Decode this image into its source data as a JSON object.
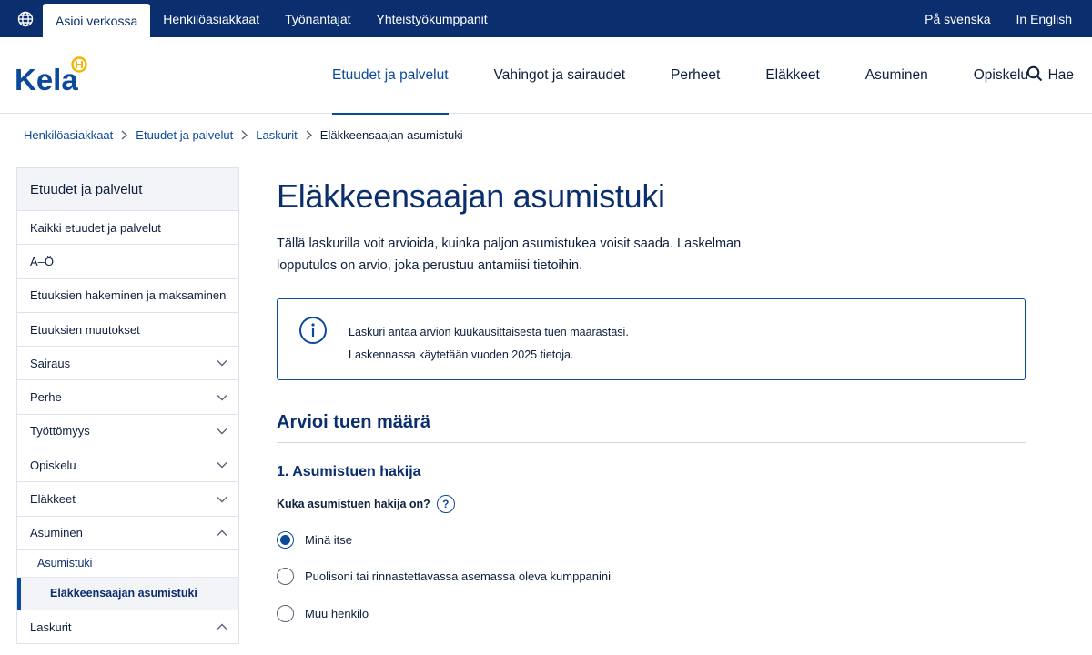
{
  "topbar": {
    "tabs": [
      "Asioi verkossa",
      "Henkilöasiakkaat",
      "Työnantajat",
      "Yhteistyökumppanit"
    ],
    "languages": [
      "På svenska",
      "In English"
    ]
  },
  "header": {
    "logo_text": "Kela",
    "nav": [
      "Etuudet ja palvelut",
      "Vahingot ja sairaudet",
      "Perheet",
      "Eläkkeet",
      "Asuminen",
      "Opiskelu"
    ],
    "search_label": "Hae"
  },
  "breadcrumb": [
    "Henkilöasiakkaat",
    "Etuudet ja palvelut",
    "Laskurit",
    "Eläkkeensaajan asumistuki"
  ],
  "sidebar": {
    "heading": "Etuudet ja palvelut",
    "items": [
      {
        "label": "Kaikki etuudet ja palvelut"
      },
      {
        "label": "A–Ö"
      },
      {
        "label": "Etuuksien hakeminen ja maksaminen"
      },
      {
        "label": "Etuuksien muutokset"
      },
      {
        "label": "Sairaus"
      },
      {
        "label": "Perhe"
      },
      {
        "label": "Työttömyys"
      },
      {
        "label": "Opiskelu"
      },
      {
        "label": "Eläkkeet"
      },
      {
        "label": "Asuminen"
      },
      {
        "label": "Asumistuki"
      },
      {
        "label": "Eläkkeensaajan asumistuki"
      },
      {
        "label": "Laskurit"
      }
    ]
  },
  "main": {
    "title": "Eläkkeensaajan asumistuki",
    "intro": "Tällä laskurilla voit arvioida, kuinka paljon asumistukea voisit saada. Laskelman lopputulos on arvio, joka perustuu antamiisi tietoihin.",
    "info_lines": [
      "Laskuri antaa arvion kuukausittaisesta tuen määrästäsi.",
      "Laskennassa käytetään vuoden 2025 tietoja."
    ],
    "section_title": "Arvioi tuen määrä",
    "step_title": "1. Asumistuen hakija",
    "question": "Kuka asumistuen hakija on?",
    "help_symbol": "?",
    "options": [
      "Minä itse",
      "Puolisoni tai rinnastettavassa asemassa oleva kumppanini",
      "Muu henkilö"
    ],
    "selected_option": "Minä itse"
  },
  "colors": {
    "brand_navy": "#0b2f6e",
    "link_blue": "#0b4a9a",
    "logo_yellow": "#f4b400"
  }
}
